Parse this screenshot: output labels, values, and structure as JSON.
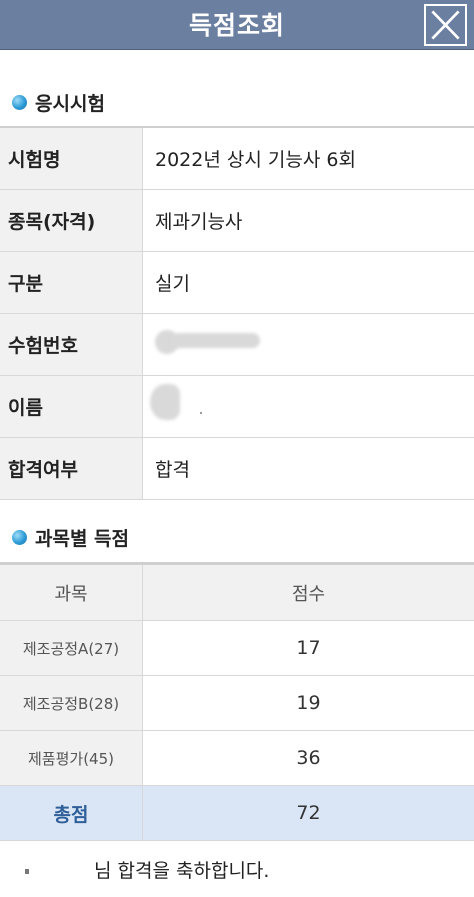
{
  "header": {
    "title": "득점조회",
    "close_icon": "close-icon"
  },
  "exam_section": {
    "title": "응시시험",
    "rows": [
      {
        "label": "시험명",
        "value": "2022년 상시 기능사 6회"
      },
      {
        "label": "종목(자격)",
        "value": "제과기능사"
      },
      {
        "label": "구분",
        "value": "실기"
      },
      {
        "label": "수험번호",
        "value": ""
      },
      {
        "label": "이름",
        "value": ""
      },
      {
        "label": "합격여부",
        "value": "합격"
      }
    ]
  },
  "score_section": {
    "title": "과목별 득점",
    "headers": {
      "subject": "과목",
      "score": "점수"
    },
    "rows": [
      {
        "subject": "제조공정A(27)",
        "score": "17"
      },
      {
        "subject": "제조공정B(28)",
        "score": "19"
      },
      {
        "subject": "제품평가(45)",
        "score": "36"
      }
    ],
    "total": {
      "label": "총점",
      "score": "72"
    }
  },
  "congrats_message": "님 합격을 축하합니다.",
  "colors": {
    "header_bg": "#6b7fa0",
    "label_bg": "#f1f1f1",
    "total_bg": "#dae6f6",
    "total_label": "#2f5f99",
    "bullet": "#2d9bd6"
  }
}
